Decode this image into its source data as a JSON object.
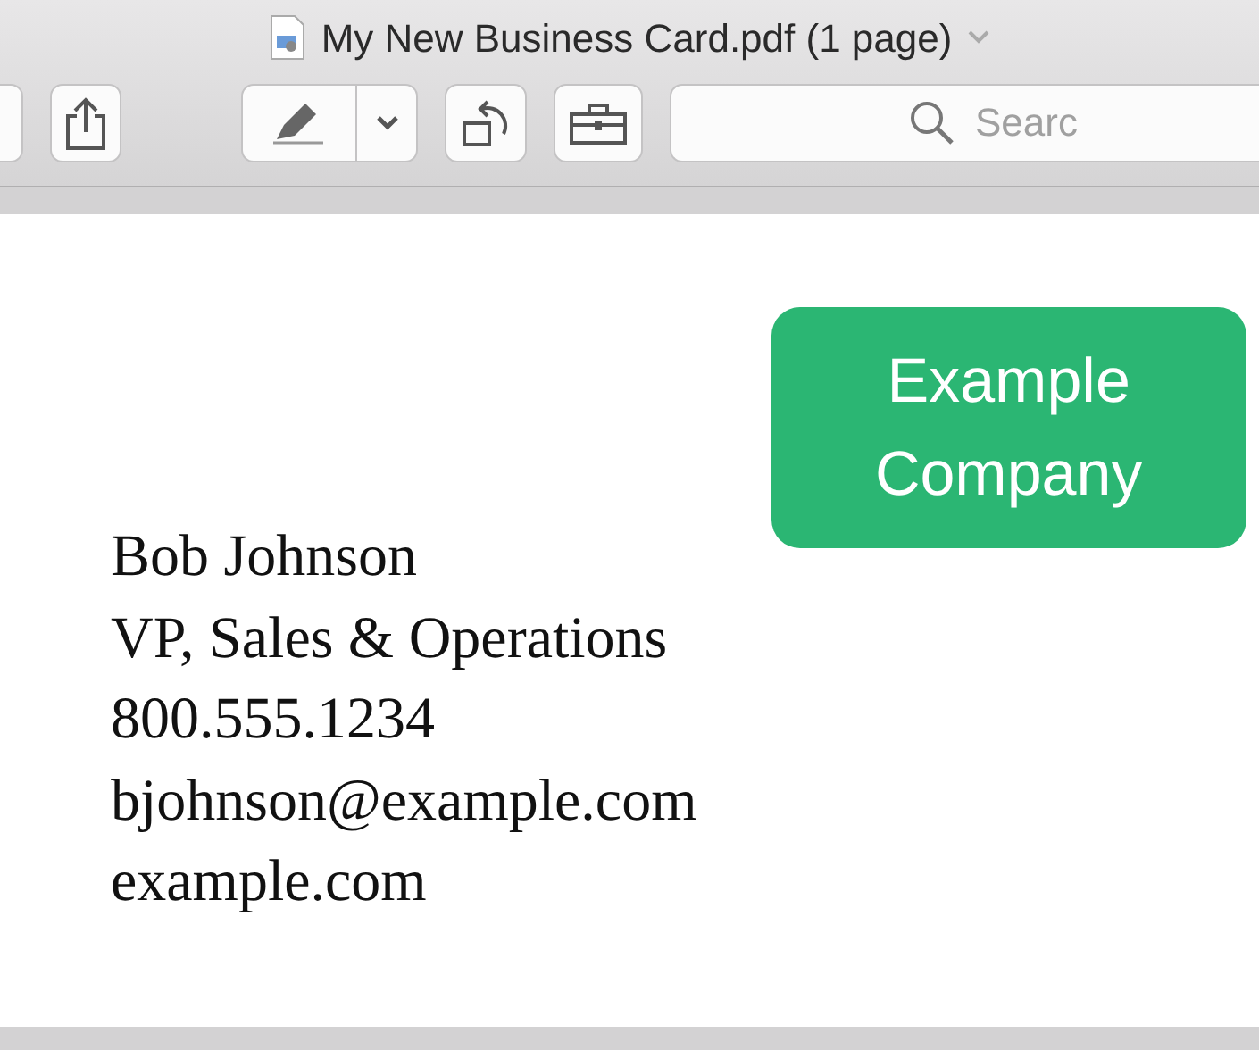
{
  "window": {
    "title": "My New Business Card.pdf (1 page)"
  },
  "toolbar": {
    "search": {
      "placeholder": "Searc"
    }
  },
  "card": {
    "company": "Example Company",
    "lines": [
      "Bob Johnson",
      "VP, Sales & Operations",
      "800.555.1234",
      "bjohnson@example.com",
      "example.com"
    ]
  }
}
